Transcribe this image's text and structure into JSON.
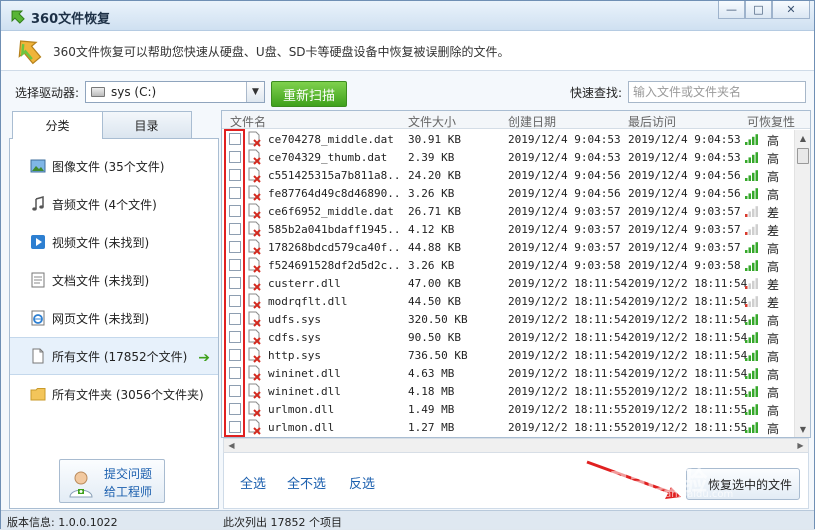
{
  "window": {
    "title": "360文件恢复",
    "minimize": "—",
    "maximize": "□",
    "close": "✕"
  },
  "banner": {
    "text": "360文件恢复可以帮助您快速从硬盘、U盘、SD卡等硬盘设备中恢复被误删除的文件。"
  },
  "drive": {
    "label": "选择驱动器:",
    "value": "sys (C:)",
    "rescan": "重新扫描"
  },
  "search": {
    "label": "快速查找:",
    "placeholder": "输入文件或文件夹名"
  },
  "tabs": [
    {
      "label": "分类"
    },
    {
      "label": "目录"
    }
  ],
  "categories": [
    {
      "label": "图像文件 (35个文件)",
      "icon": "image-icon"
    },
    {
      "label": "音频文件 (4个文件)",
      "icon": "music-icon"
    },
    {
      "label": "视频文件 (未找到)",
      "icon": "video-icon"
    },
    {
      "label": "文档文件 (未找到)",
      "icon": "document-icon"
    },
    {
      "label": "网页文件 (未找到)",
      "icon": "webpage-icon"
    },
    {
      "label": "所有文件 (17852个文件)",
      "icon": "file-icon",
      "selected": true
    },
    {
      "label": "所有文件夹 (3056个文件夹)",
      "icon": "folder-icon"
    }
  ],
  "ask": {
    "line1": "提交问题",
    "line2": "给工程师"
  },
  "columns": {
    "name": "文件名",
    "size": "文件大小",
    "created": "创建日期",
    "accessed": "最后访问",
    "recoverability": "可恢复性"
  },
  "files": [
    {
      "name": "ce704278_middle.dat",
      "size": "30.91 KB",
      "created": "2019/12/4 9:04:53",
      "accessed": "2019/12/4 9:04:53",
      "rec": "高",
      "level": "high"
    },
    {
      "name": "ce704329_thumb.dat",
      "size": "2.39 KB",
      "created": "2019/12/4 9:04:53",
      "accessed": "2019/12/4 9:04:53",
      "rec": "高",
      "level": "high"
    },
    {
      "name": "c551425315a7b811a8...",
      "size": "24.20 KB",
      "created": "2019/12/4 9:04:56",
      "accessed": "2019/12/4 9:04:56",
      "rec": "高",
      "level": "high"
    },
    {
      "name": "fe87764d49c8d46890...",
      "size": "3.26 KB",
      "created": "2019/12/4 9:04:56",
      "accessed": "2019/12/4 9:04:56",
      "rec": "高",
      "level": "high"
    },
    {
      "name": "ce6f6952_middle.dat",
      "size": "26.71 KB",
      "created": "2019/12/4 9:03:57",
      "accessed": "2019/12/4 9:03:57",
      "rec": "差",
      "level": "low"
    },
    {
      "name": "585b2a041bdaff1945...",
      "size": "4.12 KB",
      "created": "2019/12/4 9:03:57",
      "accessed": "2019/12/4 9:03:57",
      "rec": "差",
      "level": "low"
    },
    {
      "name": "178268bdcd579ca40f...",
      "size": "44.88 KB",
      "created": "2019/12/4 9:03:57",
      "accessed": "2019/12/4 9:03:57",
      "rec": "高",
      "level": "high"
    },
    {
      "name": "f524691528df2d5d2c...",
      "size": "3.26 KB",
      "created": "2019/12/4 9:03:58",
      "accessed": "2019/12/4 9:03:58",
      "rec": "高",
      "level": "high"
    },
    {
      "name": "custerr.dll",
      "size": "47.00 KB",
      "created": "2019/12/2 18:11:54",
      "accessed": "2019/12/2 18:11:54",
      "rec": "差",
      "level": "low"
    },
    {
      "name": "modrqflt.dll",
      "size": "44.50 KB",
      "created": "2019/12/2 18:11:54",
      "accessed": "2019/12/2 18:11:54",
      "rec": "差",
      "level": "low"
    },
    {
      "name": "udfs.sys",
      "size": "320.50 KB",
      "created": "2019/12/2 18:11:54",
      "accessed": "2019/12/2 18:11:54",
      "rec": "高",
      "level": "high"
    },
    {
      "name": "cdfs.sys",
      "size": "90.50 KB",
      "created": "2019/12/2 18:11:54",
      "accessed": "2019/12/2 18:11:54",
      "rec": "高",
      "level": "high"
    },
    {
      "name": "http.sys",
      "size": "736.50 KB",
      "created": "2019/12/2 18:11:54",
      "accessed": "2019/12/2 18:11:54",
      "rec": "高",
      "level": "high"
    },
    {
      "name": "wininet.dll",
      "size": "4.63 MB",
      "created": "2019/12/2 18:11:54",
      "accessed": "2019/12/2 18:11:54",
      "rec": "高",
      "level": "high"
    },
    {
      "name": "wininet.dll",
      "size": "4.18 MB",
      "created": "2019/12/2 18:11:55",
      "accessed": "2019/12/2 18:11:55",
      "rec": "高",
      "level": "high"
    },
    {
      "name": "urlmon.dll",
      "size": "1.49 MB",
      "created": "2019/12/2 18:11:55",
      "accessed": "2019/12/2 18:11:55",
      "rec": "高",
      "level": "high"
    },
    {
      "name": "urlmon.dll",
      "size": "1.27 MB",
      "created": "2019/12/2 18:11:55",
      "accessed": "2019/12/2 18:11:55",
      "rec": "高",
      "level": "high"
    }
  ],
  "actions": {
    "select_all": "全选",
    "select_none": "全不选",
    "invert": "反选",
    "recover": "恢复选中的文件"
  },
  "watermark": {
    "brand": "Bai经验",
    "url": "jingyan.baidu.com"
  },
  "status": {
    "version": "版本信息: 1.0.0.1022",
    "count": "此次列出 17852 个项目"
  },
  "colors": {
    "accent_green": "#3fa11c",
    "link_blue": "#1b5fae",
    "highlight_red": "#e02020",
    "bar_green": "#36a82b",
    "bar_red": "#d83a2e"
  }
}
